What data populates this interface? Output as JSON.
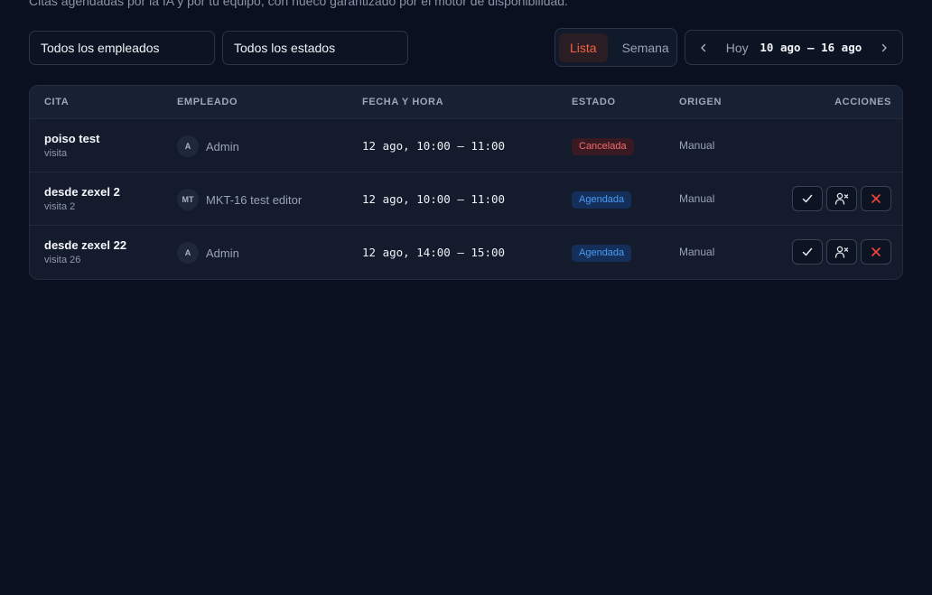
{
  "subtitle": "Citas agendadas por la IA y por tu equipo, con hueco garantizado por el motor de disponibilidad.",
  "filters": {
    "employees": "Todos los empleados",
    "statuses": "Todos los estados"
  },
  "view_toggle": {
    "list": "Lista",
    "week": "Semana",
    "active": "list"
  },
  "date_nav": {
    "today": "Hoy",
    "range": "10 ago – 16 ago"
  },
  "table": {
    "headers": {
      "cita": "CITA",
      "empleado": "EMPLEADO",
      "fecha": "FECHA Y HORA",
      "estado": "ESTADO",
      "origen": "ORIGEN",
      "acciones": "ACCIONES"
    },
    "rows": [
      {
        "title": "poiso test",
        "sub": "visita",
        "avatar": "A",
        "employee": "Admin",
        "datetime": "12 ago, 10:00 – 11:00",
        "status": "Cancelada",
        "status_kind": "cancelada",
        "origin": "Manual",
        "actions": false
      },
      {
        "title": "desde zexel 2",
        "sub": "visita 2",
        "avatar": "MT",
        "employee": "MKT-16 test editor",
        "datetime": "12 ago, 10:00 – 11:00",
        "status": "Agendada",
        "status_kind": "agendada",
        "origin": "Manual",
        "actions": true
      },
      {
        "title": "desde zexel 22",
        "sub": "visita 26",
        "avatar": "A",
        "employee": "Admin",
        "datetime": "12 ago, 14:00 – 15:00",
        "status": "Agendada",
        "status_kind": "agendada",
        "origin": "Manual",
        "actions": true
      }
    ]
  },
  "icons": {
    "prev": "chevron-left-icon",
    "next": "chevron-right-icon",
    "confirm": "check-icon",
    "no_show": "user-x-icon",
    "cancel": "x-icon"
  },
  "colors": {
    "accent": "#f0623f",
    "cancel_red": "#f26b6b",
    "agendada_blue": "#4a9bf5"
  }
}
